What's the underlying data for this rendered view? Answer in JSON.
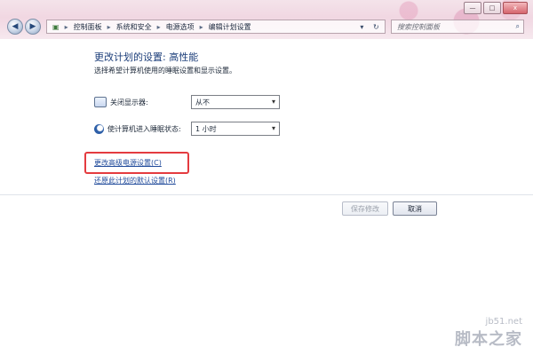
{
  "window": {
    "buttons": [
      "—",
      "□",
      "x"
    ]
  },
  "nav": {
    "breadcrumbs": [
      "控制面板",
      "系统和安全",
      "电源选项",
      "编辑计划设置"
    ],
    "search_placeholder": "搜索控制面板"
  },
  "main": {
    "title": "更改计划的设置: 高性能",
    "subtitle": "选择希望计算机使用的睡眠设置和显示设置。",
    "settings": [
      {
        "label": "关闭显示器:",
        "value": "从不"
      },
      {
        "label": "使计算机进入睡眠状态:",
        "value": "1 小时"
      }
    ],
    "links": [
      {
        "text": "更改高级电源设置(C)"
      },
      {
        "text": "还原此计划的默认设置(R)"
      }
    ]
  },
  "footer": {
    "save_label": "保存修改",
    "cancel_label": "取消"
  },
  "watermark": {
    "site": "jb51.net",
    "brand": "脚本之家"
  },
  "colors": {
    "title_blue": "#1c3e7a",
    "link_blue": "#214b9b",
    "highlight_red": "#e43b3f"
  }
}
